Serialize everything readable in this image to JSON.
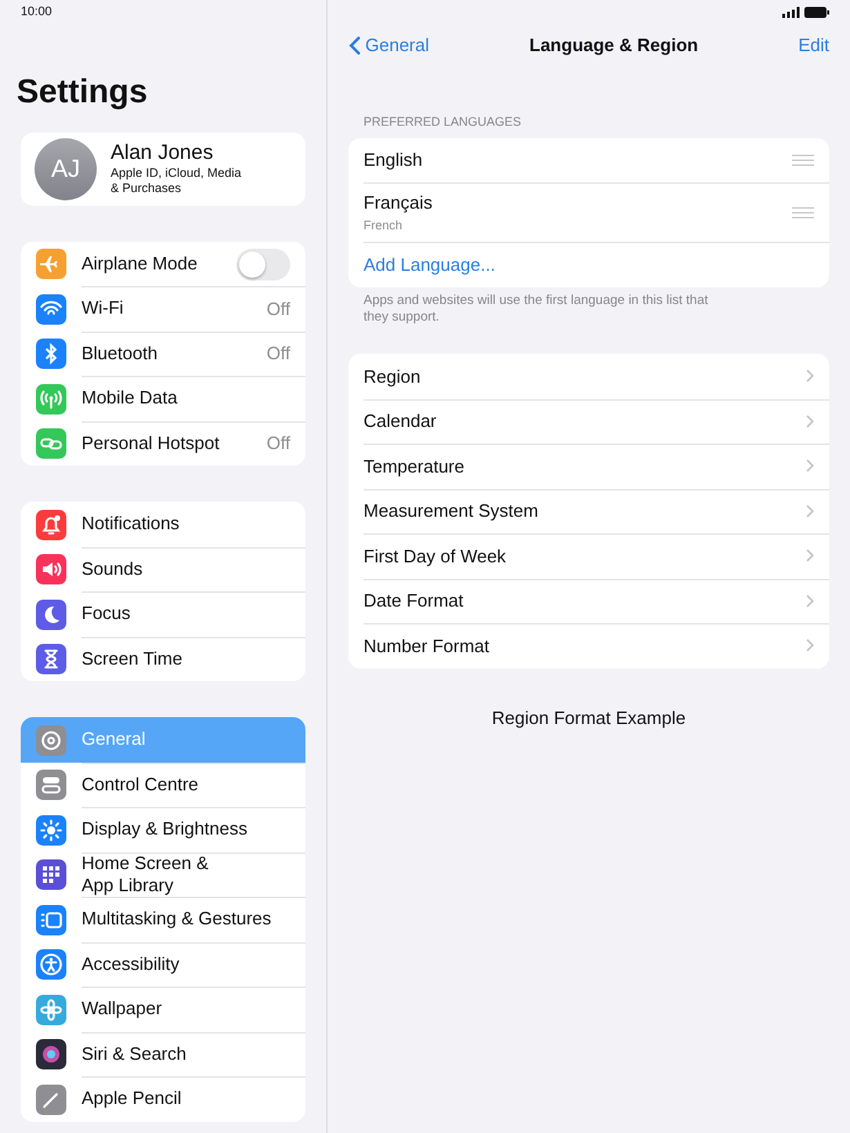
{
  "status_bar": {
    "time": "10:00"
  },
  "sidebar": {
    "title": "Settings",
    "profile": {
      "initials": "AJ",
      "name": "Alan Jones",
      "subtitle": "Apple ID, iCloud, Media\n& Purchases"
    },
    "groups": [
      [
        {
          "label": "Airplane Mode",
          "kind": "toggle",
          "on": false,
          "color": "#f7a032",
          "selected": false
        },
        {
          "label": "Wi-Fi",
          "kind": "value",
          "value": "Off",
          "color": "#1a82fb",
          "selected": false
        },
        {
          "label": "Bluetooth",
          "kind": "value",
          "value": "Off",
          "color": "#1a82fb",
          "selected": false
        },
        {
          "label": "Mobile Data",
          "kind": "plain",
          "color": "#34c759",
          "selected": false
        },
        {
          "label": "Personal Hotspot",
          "kind": "value",
          "value": "Off",
          "color": "#34c759",
          "selected": false
        }
      ],
      [
        {
          "label": "Notifications",
          "kind": "plain",
          "color": "#fb3c3c",
          "selected": false
        },
        {
          "label": "Sounds",
          "kind": "plain",
          "color": "#f8325a",
          "selected": false
        },
        {
          "label": "Focus",
          "kind": "plain",
          "color": "#5e5ce6",
          "selected": false
        },
        {
          "label": "Screen Time",
          "kind": "plain",
          "color": "#5e5ce6",
          "selected": false
        }
      ],
      [
        {
          "label": "General",
          "kind": "plain",
          "color": "#8e8e93",
          "selected": true
        },
        {
          "label": "Control Centre",
          "kind": "plain",
          "color": "#8e8e93",
          "selected": false
        },
        {
          "label": "Display & Brightness",
          "kind": "plain",
          "color": "#1a82fb",
          "selected": false
        },
        {
          "label": "Home Screen &\nApp Library",
          "kind": "plain",
          "color": "#5b4fd8",
          "selected": false
        },
        {
          "label": "Multitasking & Gestures",
          "kind": "plain",
          "color": "#1a82fb",
          "selected": false
        },
        {
          "label": "Accessibility",
          "kind": "plain",
          "color": "#1a82fb",
          "selected": false
        },
        {
          "label": "Wallpaper",
          "kind": "plain",
          "color": "#36aadc",
          "selected": false
        },
        {
          "label": "Siri & Search",
          "kind": "plain",
          "color": "#2a2a3a",
          "selected": false
        },
        {
          "label": "Apple Pencil",
          "kind": "plain",
          "color": "#8e8e93",
          "selected": false
        }
      ]
    ]
  },
  "nav": {
    "back": "General",
    "title": "Language & Region",
    "action": "Edit"
  },
  "languages": {
    "header": "PREFERRED LANGUAGES",
    "items": [
      {
        "name": "English"
      },
      {
        "name": "Français",
        "subtitle": "French"
      }
    ],
    "add": "Add Language...",
    "footer": "Apps and websites will use the first language in this list that they support."
  },
  "region_items": [
    "Region",
    "Calendar",
    "Temperature",
    "Measurement System",
    "First Day of Week",
    "Date Format",
    "Number Format"
  ],
  "region_format_example": "Region Format Example"
}
